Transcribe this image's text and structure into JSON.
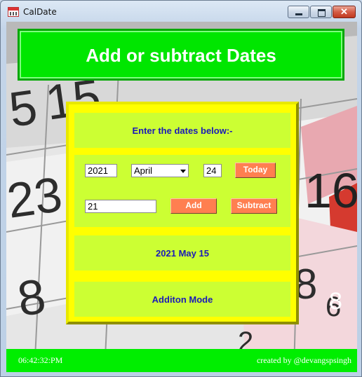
{
  "window": {
    "title": "CalDate",
    "close_glyph": "✕"
  },
  "colors": {
    "header": "#00e600",
    "panel": "#ffff00",
    "subpanel": "#ccff33",
    "button": "#ff7f50",
    "text": "#1a1ab8",
    "status": "#00ee00"
  },
  "header": {
    "title": "Add or subtract Dates"
  },
  "prompt": "Enter the dates below:-",
  "date_inputs": {
    "year": "2021",
    "month": "April",
    "day": "24"
  },
  "buttons": {
    "today": "Today",
    "add": "Add",
    "subtract": "Subtract"
  },
  "amount_input": "21",
  "result": "2021 May 15",
  "mode": "Additon Mode",
  "status": {
    "time": "06:42:32:PM",
    "credit": "created by @devangspsingh"
  },
  "background": {
    "calendar_numbers": [
      "5",
      "15",
      "23",
      "8",
      "16",
      "8",
      "6",
      "2",
      "8"
    ]
  }
}
